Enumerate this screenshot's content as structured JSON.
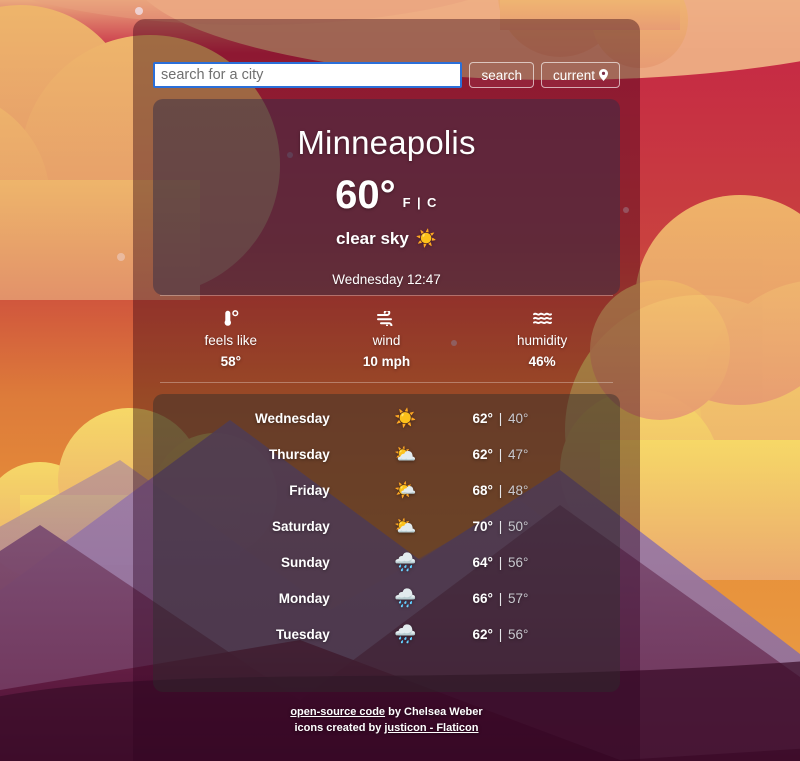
{
  "search": {
    "placeholder": "search for a city",
    "value": "",
    "search_label": "search",
    "current_label": "current",
    "location_icon": "map-pin-icon"
  },
  "current": {
    "city": "Minneapolis",
    "temperature": "60°",
    "units_toggle": "F | C",
    "description": "clear sky",
    "description_icon": "☀️",
    "datetime": "Wednesday 12:47"
  },
  "stats": [
    {
      "icon": "thermometer-icon",
      "label": "feels like",
      "value": "58°"
    },
    {
      "icon": "wind-icon",
      "label": "wind",
      "value": "10 mph"
    },
    {
      "icon": "humidity-icon",
      "label": "humidity",
      "value": "46%"
    }
  ],
  "forecast": [
    {
      "day": "Wednesday",
      "icon": "☀️",
      "icon_name": "sun-icon",
      "high": "62°",
      "low": "40°"
    },
    {
      "day": "Thursday",
      "icon": "⛅",
      "icon_name": "cloud-icon",
      "high": "62°",
      "low": "47°"
    },
    {
      "day": "Friday",
      "icon": "🌤️",
      "icon_name": "sun-cloud-icon",
      "high": "68°",
      "low": "48°"
    },
    {
      "day": "Saturday",
      "icon": "⛅",
      "icon_name": "cloud-icon",
      "high": "70°",
      "low": "50°"
    },
    {
      "day": "Sunday",
      "icon": "🌧️",
      "icon_name": "rain-icon",
      "high": "64°",
      "low": "56°"
    },
    {
      "day": "Monday",
      "icon": "🌧️",
      "icon_name": "rain-icon",
      "high": "66°",
      "low": "57°"
    },
    {
      "day": "Tuesday",
      "icon": "🌧️",
      "icon_name": "rain-icon",
      "high": "62°",
      "low": "56°"
    }
  ],
  "footer": {
    "code_link": "open-source code",
    "code_by": " by Chelsea Weber",
    "icons_prefix": "icons created by ",
    "icons_link": "justicon - Flaticon"
  },
  "colors": {
    "sky_top": "#e8a87c",
    "sky_red": "#bf2a45",
    "sky_orange": "#e08a3c",
    "cloud_orange": "#e8a75e",
    "cloud_yellow": "#f5d264",
    "mountain_purple": "#8b6f9e",
    "mountain_dark": "#4a0f2e",
    "input_border": "#2b6fd8"
  }
}
